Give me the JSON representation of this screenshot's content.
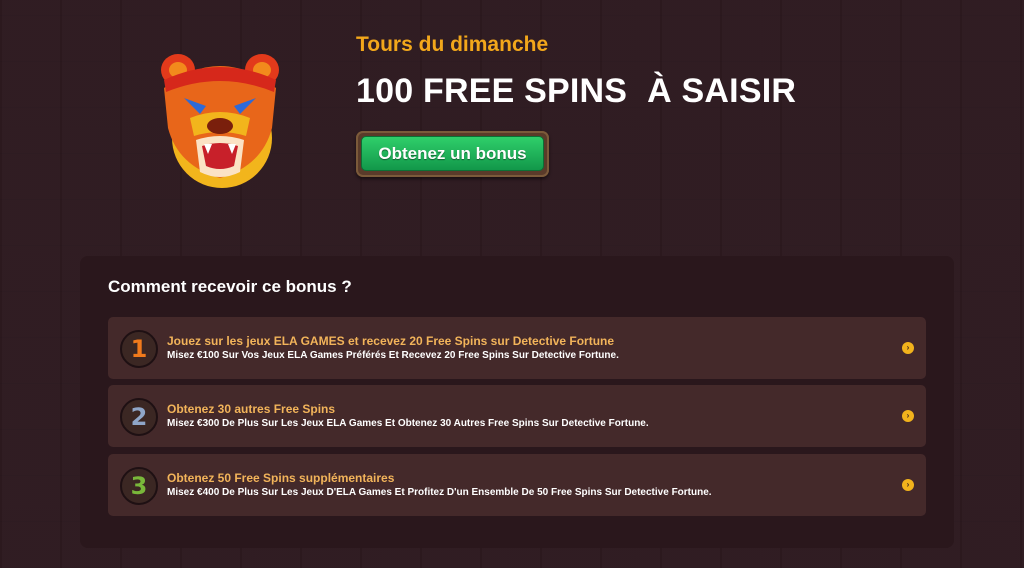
{
  "hero": {
    "subtitle": "Tours du dimanche",
    "headline_part1": "100 FREE SPINS",
    "headline_part2": "À SAISIR",
    "button_label": "Obtenez un bonus"
  },
  "bonus_panel": {
    "title": "Comment recevoir ce bonus ?",
    "steps": [
      {
        "number": "1",
        "title": "Jouez sur les jeux ELA GAMES et recevez 20 Free Spins sur Detective Fortune",
        "description": "Misez €100 Sur Vos Jeux ELA Games Préférés Et Recevez 20 Free Spins Sur Detective Fortune.",
        "number_color": "#f07a1c"
      },
      {
        "number": "2",
        "title": "Obtenez 30 autres Free Spins",
        "description": "Misez €300 De Plus Sur Les Jeux ELA Games Et Obtenez 30 Autres Free Spins Sur Detective Fortune.",
        "number_color": "#8fa6c8"
      },
      {
        "number": "3",
        "title": "Obtenez 50 Free Spins supplémentaires",
        "description": "Misez €400 De Plus Sur Les Jeux D'ELA Games Et Profitez D'un Ensemble De 50 Free Spins Sur Detective Fortune.",
        "number_color": "#79b83a"
      }
    ]
  },
  "colors": {
    "accent": "#f2a71b",
    "button_green": "#1fb55a",
    "background": "#2e1a20",
    "panel": "#2a171c",
    "card": "#44292a"
  },
  "icons": {
    "logo": "bear-head-logo",
    "step_arrow": "chevron-right-icon"
  }
}
